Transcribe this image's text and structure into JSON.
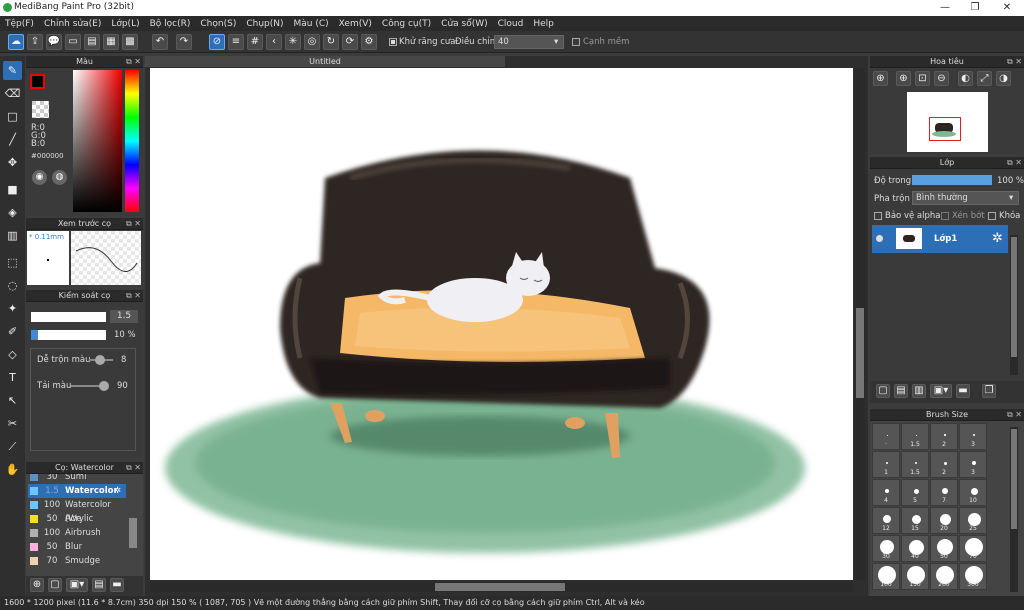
{
  "window": {
    "title": "MediBang Paint Pro (32bit)",
    "min": "—",
    "max": "❐",
    "close": "✕"
  },
  "menu": [
    "Tệp(F)",
    "Chỉnh sửa(E)",
    "Lớp(L)",
    "Bộ lọc(R)",
    "Chọn(S)",
    "Chụp(N)",
    "Màu (C)",
    "Xem(V)",
    "Công cụ(T)",
    "Cửa sổ(W)",
    "Cloud",
    "Help"
  ],
  "toolbar": {
    "antialias_label": "Khử răng cưa",
    "adjust_label": "Điều chỉnh",
    "adjust_value": "40",
    "snap_label": "Cạnh mềm"
  },
  "canvas_tab": "Untitled",
  "color_panel": {
    "title": "Màu",
    "rgb_r": "R:0",
    "rgb_g": "G:0",
    "rgb_b": "B:0",
    "hex": "#000000",
    "fg": "#000000",
    "bg": "#ffffff"
  },
  "brush_preview": {
    "title": "Xem trước cọ",
    "size": "* 0.11mm"
  },
  "brush_control": {
    "title": "Kiểm soát cọ",
    "size_val": "1.5",
    "opacity_val": "10 %",
    "blend_label": "Dễ trộn màu",
    "blend_val": "8",
    "paint_label": "Tải màu",
    "paint_val": "90"
  },
  "brush_list": {
    "title": "Cọ: Watercolor",
    "items": [
      {
        "n": "30",
        "name": "Sumi",
        "color": "#5a8fc7"
      },
      {
        "n": "1.5",
        "name": "Watercolor",
        "color": "#6ec6ff"
      },
      {
        "n": "100",
        "name": "Watercolor (We",
        "color": "#6ec6ff"
      },
      {
        "n": "50",
        "name": "Acrylic",
        "color": "#f0e020"
      },
      {
        "n": "100",
        "name": "Airbrush",
        "color": "#b0b0b0"
      },
      {
        "n": "50",
        "name": "Blur",
        "color": "#ffb0e0"
      },
      {
        "n": "70",
        "name": "Smudge",
        "color": "#f0d0b0"
      }
    ]
  },
  "navigator": {
    "title": "Hoa tiêu"
  },
  "layer_panel": {
    "title": "Lớp",
    "opacity_label": "Độ trong",
    "opacity_val": "100 %",
    "opacity": 1.0,
    "blend_label": "Pha trộn",
    "blend_val": "Bình thường",
    "protect_alpha": "Bảo vệ alpha",
    "clip": "Xén bớt",
    "lock": "Khóa",
    "layer_name": "Lớp1"
  },
  "brush_size": {
    "title": "Brush Size",
    "sizes": [
      "·",
      "1.5",
      "2",
      "3",
      "1",
      "1.5",
      "2",
      "3",
      "4",
      "5",
      "7",
      "10",
      "12",
      "15",
      "20",
      "25",
      "30",
      "40",
      "50",
      "70",
      "100",
      "150",
      "200",
      "300"
    ]
  },
  "status": "1600 * 1200 pixel   (11.6 * 8.7cm)   350 dpi   150 %   ( 1087, 705 )   Vẽ một đường thẳng bằng cách giữ phím Shift, Thay đổi cỡ cọ bằng cách giữ phím Ctrl, Alt và kéo"
}
